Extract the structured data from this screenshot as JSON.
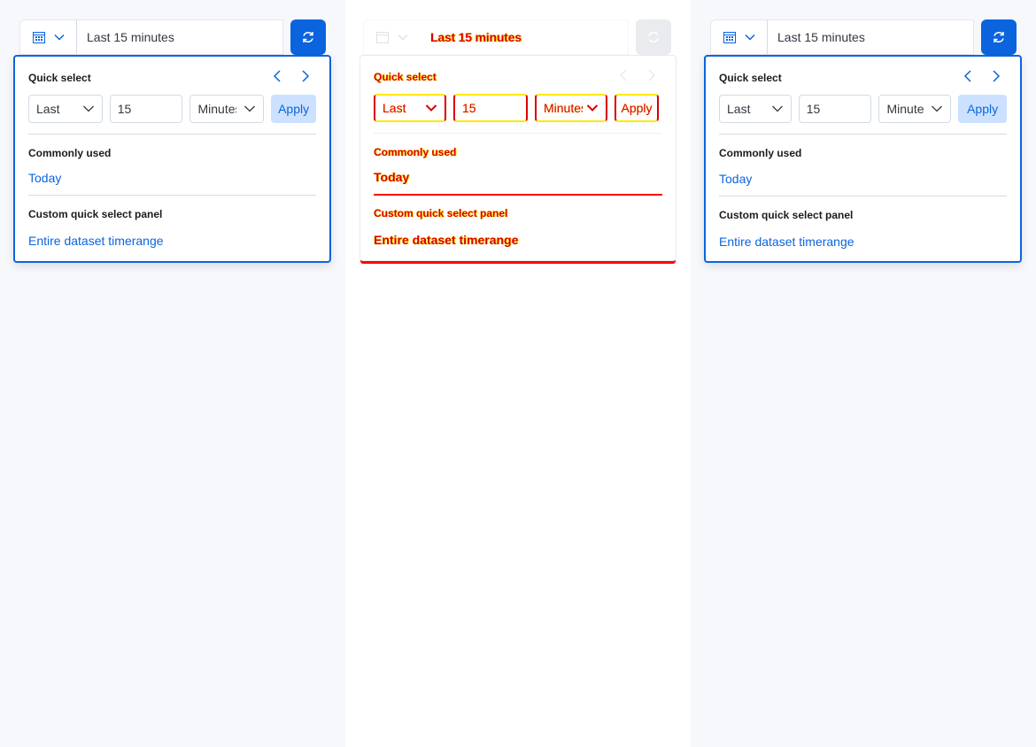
{
  "picker": {
    "range_text": "Last 15 minutes"
  },
  "quick_select": {
    "title": "Quick select",
    "direction": "Last",
    "value": "15",
    "unit_left": "Minutes",
    "unit_right": "Minute",
    "apply_label": "Apply"
  },
  "commonly_used": {
    "title": "Commonly used",
    "items": [
      "Today"
    ]
  },
  "custom_panel": {
    "title": "Custom quick select panel",
    "items": [
      "Entire dataset timerange"
    ]
  },
  "icons": {
    "calendar": "calendar-icon",
    "chevron_down": "chevron-down-icon",
    "refresh": "refresh-icon",
    "arrow_left": "arrow-left-icon",
    "arrow_right": "arrow-right-icon"
  },
  "colors": {
    "primary": "#0b64dd",
    "apply_bg": "#cce1ff",
    "diff_red": "#d90000",
    "diff_yellow": "#ffe800"
  }
}
